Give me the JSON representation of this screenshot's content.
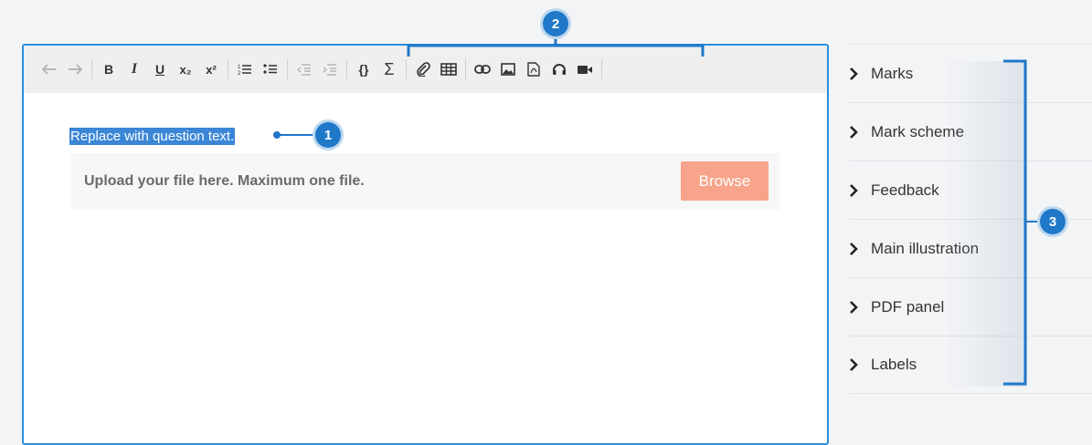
{
  "editor": {
    "question_text": "Replace with question text.",
    "upload_text": "Upload your file here. Maximum one file.",
    "browse_label": "Browse"
  },
  "toolbar": {
    "buttons": [
      {
        "icon": "undo-icon",
        "glyph": "↶",
        "enabled": false
      },
      {
        "icon": "redo-icon",
        "glyph": "↷",
        "enabled": false
      },
      {
        "icon": "bold-icon",
        "glyph": "B",
        "enabled": true
      },
      {
        "icon": "italic-icon",
        "glyph": "I",
        "enabled": true
      },
      {
        "icon": "underline-icon",
        "glyph": "U",
        "enabled": true
      },
      {
        "icon": "subscript-icon",
        "glyph": "x₂",
        "enabled": true
      },
      {
        "icon": "superscript-icon",
        "glyph": "x²",
        "enabled": true
      },
      {
        "icon": "numbered-list-icon",
        "glyph": "1≡",
        "enabled": true
      },
      {
        "icon": "bullet-list-icon",
        "glyph": "•≡",
        "enabled": true
      },
      {
        "icon": "outdent-icon",
        "glyph": "⇤",
        "enabled": false
      },
      {
        "icon": "indent-icon",
        "glyph": "⇥",
        "enabled": false
      },
      {
        "icon": "code-icon",
        "glyph": "{}",
        "enabled": true
      },
      {
        "icon": "sigma-icon",
        "glyph": "Σ",
        "enabled": true
      },
      {
        "icon": "attachment-icon",
        "glyph": "📎",
        "enabled": true
      },
      {
        "icon": "table-icon",
        "glyph": "▦",
        "enabled": true
      },
      {
        "icon": "link-icon",
        "glyph": "⛓",
        "enabled": true
      },
      {
        "icon": "image-icon",
        "glyph": "▣",
        "enabled": true
      },
      {
        "icon": "pdf-icon",
        "glyph": "⎘",
        "enabled": true
      },
      {
        "icon": "headphones-icon",
        "glyph": "∩",
        "enabled": true
      },
      {
        "icon": "video-icon",
        "glyph": "■",
        "enabled": true
      }
    ]
  },
  "sidebar": {
    "items": [
      {
        "label": "Marks"
      },
      {
        "label": "Mark scheme"
      },
      {
        "label": "Feedback"
      },
      {
        "label": "Main illustration"
      },
      {
        "label": "PDF panel"
      },
      {
        "label": "Labels"
      }
    ]
  },
  "callouts": {
    "c1": "1",
    "c2": "2",
    "c3": "3"
  },
  "colors": {
    "accent": "#1f78c8",
    "browse": "#f7a48a",
    "selection": "#3b86d6"
  }
}
